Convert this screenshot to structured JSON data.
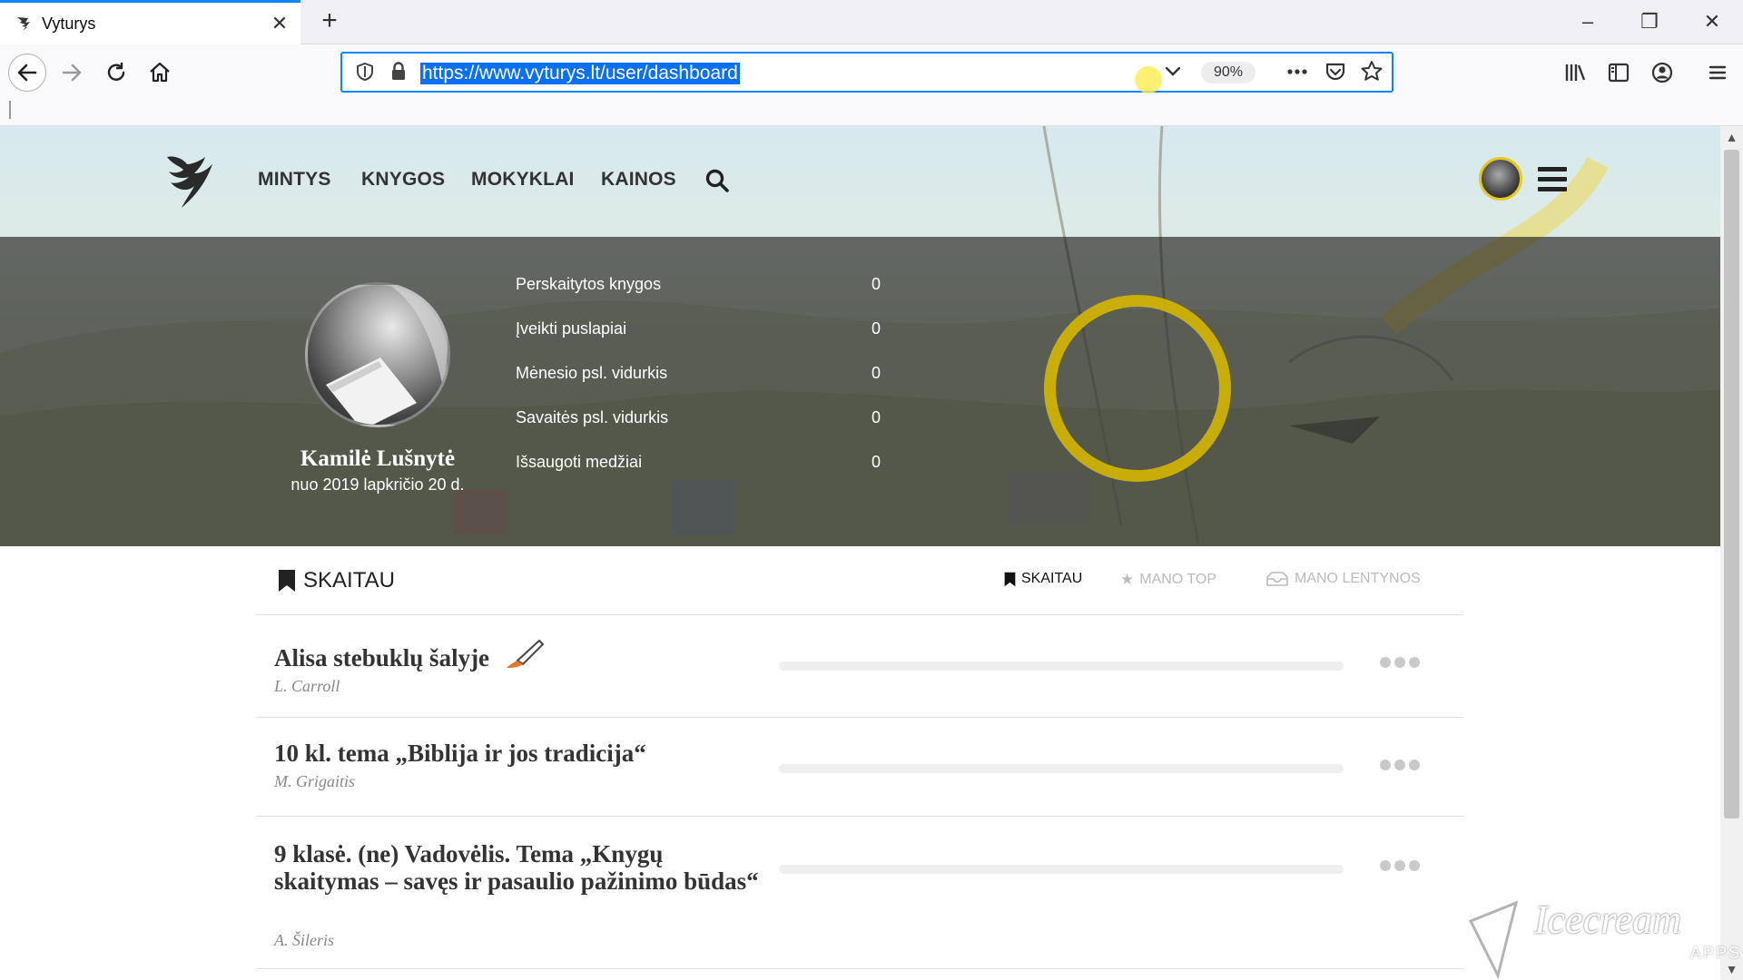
{
  "browser": {
    "tab_title": "Vyturys",
    "url": "https://www.vyturys.lt/user/dashboard",
    "zoom": "90%"
  },
  "nav": {
    "items": [
      "MINTYS",
      "KNYGOS",
      "MOKYKLAI",
      "KAINOS"
    ]
  },
  "profile": {
    "name": "Kamilė Lušnytė",
    "since": "nuo 2019 lapkričio 20 d."
  },
  "stats": [
    {
      "label": "Perskaitytos knygos",
      "value": "0"
    },
    {
      "label": "Įveikti puslapiai",
      "value": "0"
    },
    {
      "label": "Mėnesio psl. vidurkis",
      "value": "0"
    },
    {
      "label": "Savaitės psl. vidurkis",
      "value": "0"
    },
    {
      "label": "Išsaugoti medžiai",
      "value": "0"
    }
  ],
  "section": {
    "title": "SKAITAU",
    "tabs": [
      "SKAITAU",
      "MANO TOP",
      "MANO LENTYNOS"
    ]
  },
  "books": [
    {
      "title": "Alisa stebuklų šalyje",
      "author": "L. Carroll",
      "progress": 0
    },
    {
      "title": "10 kl. tema „Biblija ir jos tradicija“",
      "author": "M. Grigaitis",
      "progress": 0
    },
    {
      "title": "9 klasė. (ne) Vadovėlis. Tema „Knygų skaitymas – savęs ir pasaulio pažinimo būdas“",
      "author": "A. Šileris",
      "progress": 0
    }
  ],
  "watermark": {
    "brand": "Icecream",
    "sub": "APPS"
  },
  "colors": {
    "accent": "#0a84ff",
    "highlight_ring": "#d6b700"
  }
}
